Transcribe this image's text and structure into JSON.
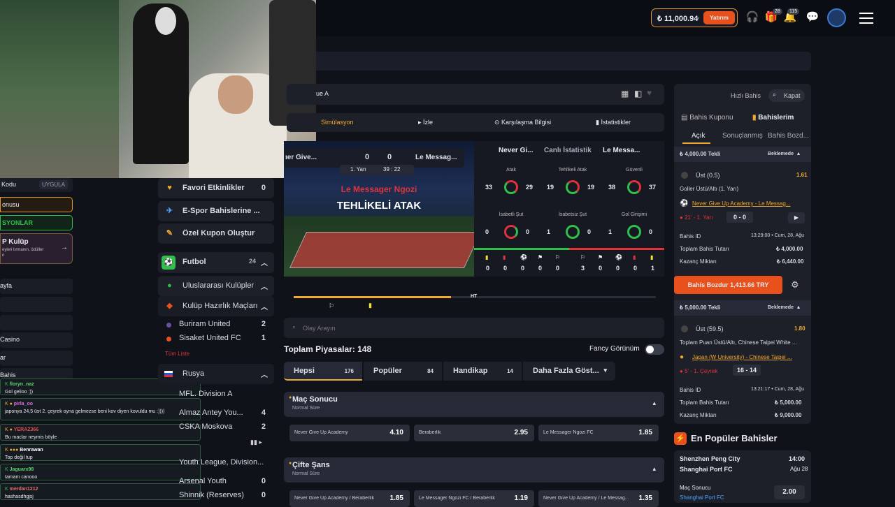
{
  "topbar": {
    "balance": "₺ 11,000.94",
    "deposit": "Yatırım",
    "gift_badge": "28",
    "bell_badge": "115"
  },
  "match": {
    "league_partial": "ue A",
    "home_short": "ıer Give...",
    "away_short": "Le Messag...",
    "score_home": "0",
    "score_away": "0",
    "half": "1. Yarı",
    "time": "39 : 22",
    "event_red": "Le Messager Ngozi",
    "event_main": "TEHLİKELİ ATAK",
    "ht": "HT"
  },
  "match_tabs": [
    "Simülasyon",
    "İzle",
    "Karşılaşma Bilgisi",
    "İstatistikler"
  ],
  "stats": {
    "home": "Never Gi...",
    "title": "Canlı İstatistik",
    "away": "Le Messa...",
    "row1": [
      {
        "label": "Atak",
        "l": "33",
        "r": "29"
      },
      {
        "label": "Tehlikeli Atak",
        "l": "19",
        "r": "19"
      },
      {
        "label": "Güvenli",
        "l": "38",
        "r": "37"
      }
    ],
    "row2": [
      {
        "label": "İsabetli Şut",
        "l": "0",
        "r": "0"
      },
      {
        "label": "İsabetsiz Şut",
        "l": "1",
        "r": "0"
      },
      {
        "label": "Gol Girişimi",
        "l": "1",
        "r": "0"
      }
    ],
    "cards_home": [
      "0",
      "0",
      "0",
      "0",
      "0"
    ],
    "cards_away": [
      "3",
      "0",
      "0",
      "0",
      "1"
    ]
  },
  "search_events": "Olay Arayın",
  "markets": {
    "total_label": "Toplam Piyasalar:",
    "total": "148",
    "fancy": "Fancy Görünüm",
    "tabs": [
      {
        "label": "Hepsi",
        "count": "176"
      },
      {
        "label": "Popüler",
        "count": "84"
      },
      {
        "label": "Handikap",
        "count": "14"
      },
      {
        "label": "Daha Fazla Göst...",
        "count": ""
      }
    ],
    "ms": {
      "title": "Maç Sonucu",
      "sub": "Normal Süre",
      "odds": [
        {
          "n": "Never Give Up Academy",
          "v": "4.10"
        },
        {
          "n": "Beraberlik",
          "v": "2.95"
        },
        {
          "n": "Le Messager Ngozi FC",
          "v": "1.85"
        }
      ]
    },
    "cs": {
      "title": "Çifte Şans",
      "sub": "Normal Süre",
      "odds": [
        {
          "n": "Never Give Up Academy / Beraberlik",
          "v": "1.85"
        },
        {
          "n": "Le Messager Ngozi FC / Beraberlik",
          "v": "1.19"
        },
        {
          "n": "Never Give Up Academy / Le Messag...",
          "v": "1.35"
        }
      ]
    }
  },
  "sidebar": {
    "fav": "Favori Etkinlikler",
    "fav_count": "0",
    "esports": "E-Spor Bahislerine ...",
    "coupon": "Özel Kupon Oluştur",
    "football": "Futbol",
    "football_count": "24",
    "intl": "Uluslararası Kulüpler",
    "club": "Kulüp Hazırlık Maçları",
    "m1": "Buriram United",
    "m1c": "2",
    "m2": "Sisaket United FC",
    "m2c": "1",
    "more": "Tüm Liste",
    "russia": "Rusya",
    "div": "MFL. Division A",
    "m3": "Almaz Antey You...",
    "m3c": "4",
    "m4": "CSKA Moskova",
    "m4c": "2",
    "youth": "Youth League, Division...",
    "m5": "Arsenal Youth",
    "m5c": "0",
    "m6": "Shinnik (Reserves)",
    "m6c": "0"
  },
  "left": {
    "code": "Kodu",
    "apply": "UYGULA",
    "bonus": "onusu",
    "promo": "SYONLAR",
    "vip_title": "P Kulüp",
    "vip_sub": "eyleri tırmanın, ödüller",
    "vip_sub2": "n",
    "items": [
      "ayfa",
      "",
      "",
      "Casino",
      "ar",
      "Bahis"
    ]
  },
  "chat": [
    {
      "u": "floryn_naz",
      "m": "Gol gelioo :))"
    },
    {
      "u": "pirla_oo",
      "m": "japonya 24,5 üst 2. çeyrek oyna gelmezse beni kov diyen kovuldu mu :))))"
    },
    {
      "u": "YERAZ366",
      "m": "Bu maclar neymis böyle"
    },
    {
      "u": "Benrawan",
      "m": "Top değil tup"
    },
    {
      "u": "Jaguarx98",
      "m": "tamam canooo"
    },
    {
      "u": "merdan1212",
      "m": "hashasdhgjsj"
    }
  ],
  "betslip": {
    "quick": "Hızlı Bahis",
    "close": "Kapat",
    "coupon": "Bahis Kuponu",
    "mybets": "Bahislerim",
    "open": "Açık",
    "settled": "Sonuçlanmış",
    "cashout": "Bahis Bozd...",
    "b1": {
      "head": "₺ 4,000.00 Tekli",
      "status": "Beklemede",
      "sel": "Üst (0.5)",
      "odd": "1.61",
      "market": "Goller Üstü/Altı (1. Yarı)",
      "match": "Never Give Up Academy - Le Messag...",
      "live": "21' - 1. Yarı",
      "score": "0 - 0",
      "id_l": "Bahis ID",
      "id_v": "13:29:00 • Cum, 28, Ağu",
      "stake_l": "Toplam Bahis Tutarı",
      "stake_v": "₺ 4,000.00",
      "win_l": "Kazanç Miktarı",
      "win_v": "₺ 6,440.00",
      "cash": "Bahis Bozdur 1,413.66 TRY"
    },
    "b2": {
      "head": "₺ 5,000.00 Tekli",
      "status": "Beklemede",
      "sel": "Üst (59.5)",
      "odd": "1.80",
      "market": "Toplam Puan Üstü/Altı, Chinese Taipei White ...",
      "match": "Japan (W University) - Chinese Taipei ...",
      "live": "5' - 1. Çeyrek",
      "score": "16 - 14",
      "id_l": "Bahis ID",
      "id_v": "13:21:17 • Cum, 28, Ağu",
      "stake_l": "Toplam Bahis Tutarı",
      "stake_v": "₺ 5,000.00",
      "win_l": "Kazanç Miktarı",
      "win_v": "₺ 9,000.00"
    },
    "popular": "En Popüler Bahisler",
    "p1h": "Shenzhen Peng City",
    "p1a": "Shanghai Port FC",
    "p1t": "14:00",
    "p1d": "Ağu 28",
    "p1m": "Maç Sonucu",
    "p1s": "Shanghai Port FC",
    "p1v": "2.00"
  },
  "colors": {
    "accent": "#e8501c",
    "gold": "#f0a830",
    "green": "#2fbf4a",
    "red": "#e0323a"
  }
}
